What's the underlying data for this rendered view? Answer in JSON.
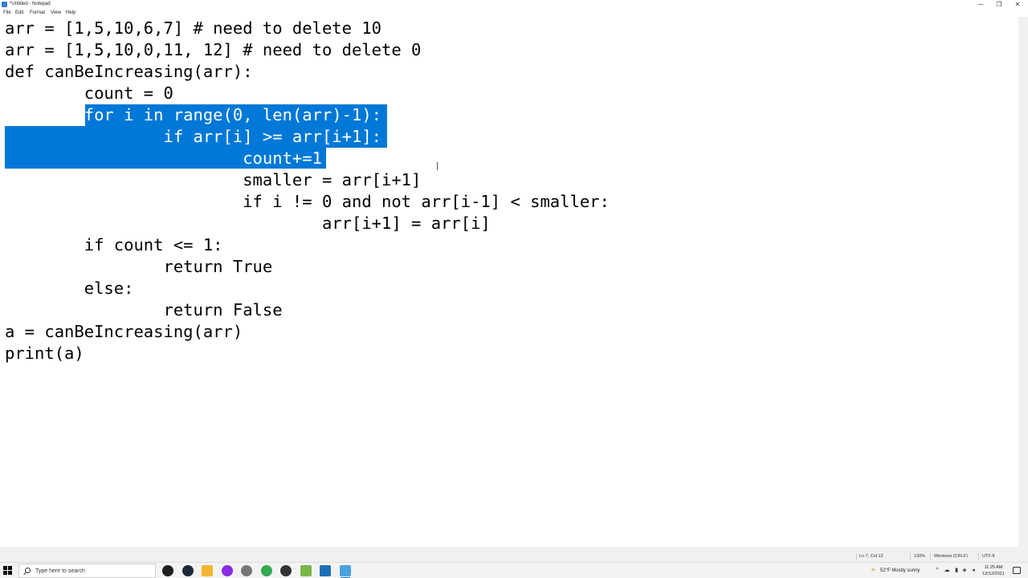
{
  "window": {
    "title": "*Untitled - Notepad",
    "minimize_glyph": "—",
    "maximize_glyph": "❐",
    "close_glyph": "✕"
  },
  "menu": {
    "items": [
      "File",
      "Edit",
      "Format",
      "View",
      "Help"
    ]
  },
  "editor": {
    "lines": [
      "arr = [1,5,10,6,7] # need to delete 10",
      "arr = [1,5,10,0,11, 12] # need to delete 0",
      "def canBeIncreasing(arr):",
      "        count = 0",
      "        for i in range(0, len(arr)-1):",
      "                if arr[i] >= arr[i+1]:",
      "                        count+=1",
      "                        smaller = arr[i+1]",
      "                        if i != 0 and not arr[i-1] < smaller:",
      "                                arr[i+1] = arr[i]",
      "        if count <= 1:",
      "                return True",
      "        else:",
      "                return False",
      "a = canBeIncreasing(arr)",
      "print(a)"
    ],
    "selection_color": "#0078d7"
  },
  "status": {
    "position": "Ln 7, Col 12",
    "zoom": "130%",
    "line_ending": "Windows (CRLF)",
    "encoding": "UTF-8"
  },
  "taskbar": {
    "search_placeholder": "Type here to search",
    "weather": "52°F  Mostly sunny",
    "time": "11:25 AM",
    "date": "12/12/2021",
    "apps": [
      {
        "name": "obs-icon",
        "color": "#1e1e1e"
      },
      {
        "name": "steam-icon",
        "color": "#1b2838"
      },
      {
        "name": "file-explorer-icon",
        "color": "#f2b632"
      },
      {
        "name": "circle-app-icon",
        "color": "#8a2be2"
      },
      {
        "name": "gamepad-icon",
        "color": "#777777"
      },
      {
        "name": "chrome-icon",
        "color": "#34a853"
      },
      {
        "name": "headset-icon",
        "color": "#333333"
      },
      {
        "name": "notepadpp-icon",
        "color": "#7ab648"
      },
      {
        "name": "powershell-icon",
        "color": "#1f6fb5"
      },
      {
        "name": "notepad-icon",
        "color": "#4aa3df"
      }
    ]
  }
}
